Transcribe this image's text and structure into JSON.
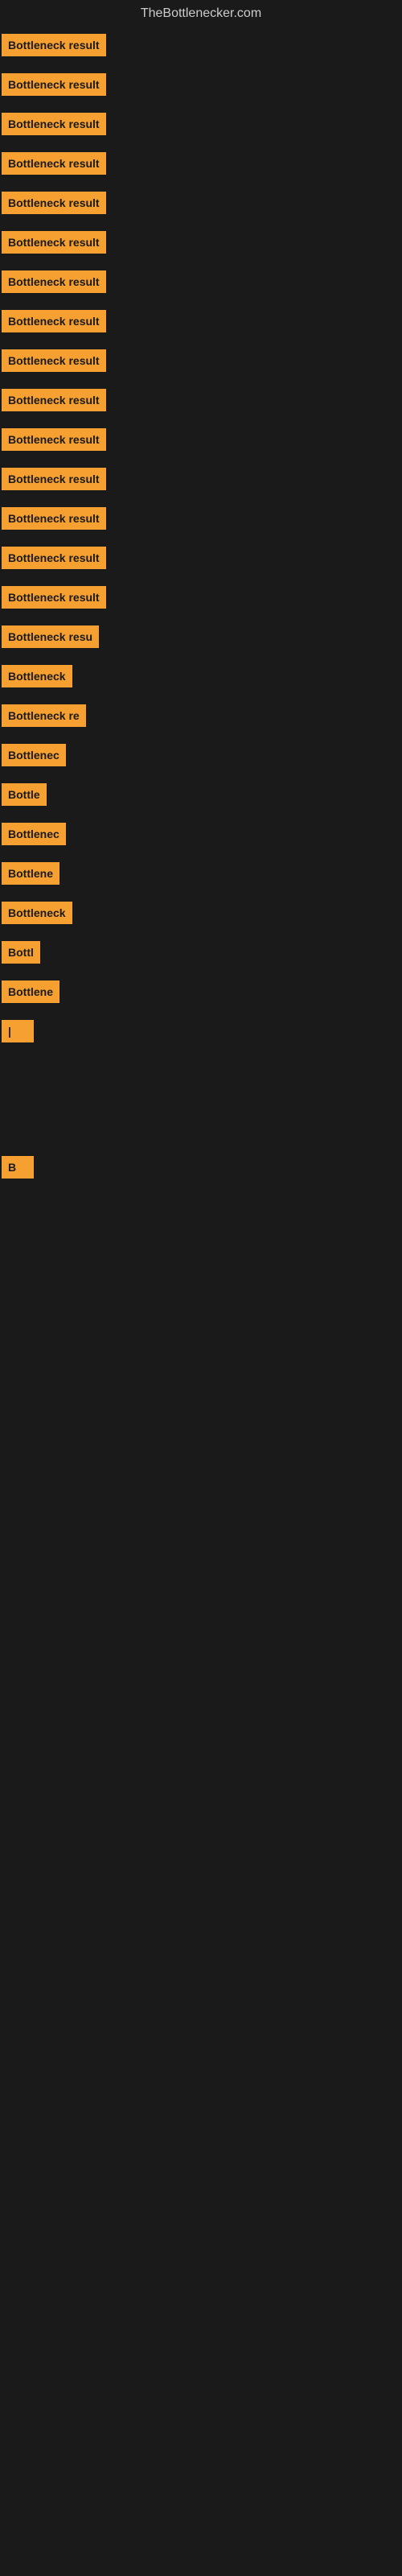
{
  "site": {
    "title": "TheBottlenecker.com"
  },
  "items": [
    {
      "label": "Bottleneck result",
      "width": 165
    },
    {
      "label": "Bottleneck result",
      "width": 165
    },
    {
      "label": "Bottleneck result",
      "width": 165
    },
    {
      "label": "Bottleneck result",
      "width": 165
    },
    {
      "label": "Bottleneck result",
      "width": 165
    },
    {
      "label": "Bottleneck result",
      "width": 165
    },
    {
      "label": "Bottleneck result",
      "width": 165
    },
    {
      "label": "Bottleneck result",
      "width": 165
    },
    {
      "label": "Bottleneck result",
      "width": 165
    },
    {
      "label": "Bottleneck result",
      "width": 165
    },
    {
      "label": "Bottleneck result",
      "width": 165
    },
    {
      "label": "Bottleneck result",
      "width": 165
    },
    {
      "label": "Bottleneck result",
      "width": 165
    },
    {
      "label": "Bottleneck result",
      "width": 165
    },
    {
      "label": "Bottleneck result",
      "width": 155
    },
    {
      "label": "Bottleneck resu",
      "width": 145
    },
    {
      "label": "Bottleneck",
      "width": 95
    },
    {
      "label": "Bottleneck re",
      "width": 120
    },
    {
      "label": "Bottlenec",
      "width": 90
    },
    {
      "label": "Bottle",
      "width": 60
    },
    {
      "label": "Bottlenec",
      "width": 90
    },
    {
      "label": "Bottlene",
      "width": 80
    },
    {
      "label": "Bottleneck",
      "width": 95
    },
    {
      "label": "Bottl",
      "width": 55
    },
    {
      "label": "Bottlene",
      "width": 80
    },
    {
      "label": "|",
      "width": 10
    },
    {
      "label": "",
      "width": 0
    },
    {
      "label": "",
      "width": 0
    },
    {
      "label": "",
      "width": 0
    },
    {
      "label": "",
      "width": 0
    },
    {
      "label": "B",
      "width": 14
    },
    {
      "label": "",
      "width": 0
    },
    {
      "label": "",
      "width": 0
    },
    {
      "label": "",
      "width": 0
    },
    {
      "label": "",
      "width": 0
    },
    {
      "label": "",
      "width": 0
    },
    {
      "label": "",
      "width": 0
    }
  ]
}
